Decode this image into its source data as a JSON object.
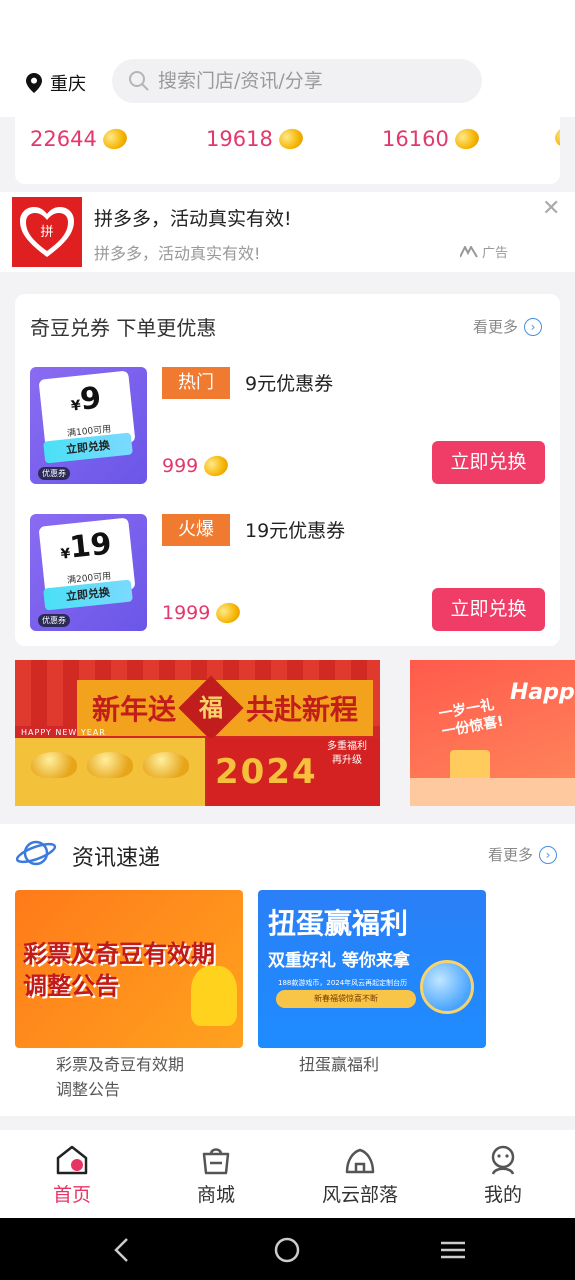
{
  "header": {
    "location": "重庆",
    "search_placeholder": "搜索门店/资讯/分享"
  },
  "points": [
    "22644",
    "19618",
    "16160"
  ],
  "ad": {
    "title": "拼多多，活动真实有效!",
    "subtitle": "拼多多，活动真实有效!",
    "tag": "广告",
    "logo_text": "拼"
  },
  "coupons": {
    "title": "奇豆兑券 下单更优惠",
    "more": "看更多",
    "items": [
      {
        "tag": "热门",
        "name": "9元优惠券",
        "price": "999",
        "button": "立即兑换",
        "img_amount": "9",
        "img_cond": "满100可用",
        "img_btn": "立即兑换",
        "img_tag": "优惠券"
      },
      {
        "tag": "火爆",
        "name": "19元优惠券",
        "price": "1999",
        "button": "立即兑换",
        "img_amount": "19",
        "img_cond": "满200可用",
        "img_btn": "立即兑换",
        "img_tag": "优惠券"
      }
    ]
  },
  "banners": {
    "b1_left": "新年送",
    "b1_fu": "福",
    "b1_right": "共赴新程",
    "b1_hny": "HAPPY NEW YEAR",
    "b1_year": "2024",
    "b1_side": "多重福利 再升级",
    "b2_text1": "一岁一礼",
    "b2_text2": "一份惊喜!",
    "b2_happy": "Happy"
  },
  "news": {
    "title": "资讯速递",
    "more": "看更多",
    "items": [
      {
        "img_text1": "彩票及奇豆有效期",
        "img_text2": "调整公告",
        "caption1": "彩票及奇豆有效期",
        "caption2": "调整公告"
      },
      {
        "img_big": "扭蛋赢福利",
        "img_mid": "双重好礼 等你来拿",
        "img_small": "188款游戏币，2024年风云再起定制台历",
        "img_badge": "新春福袋惊喜不断",
        "caption1": "扭蛋赢福利"
      }
    ]
  },
  "tabs": [
    {
      "label": "首页",
      "icon": "home-icon"
    },
    {
      "label": "商城",
      "icon": "shop-icon"
    },
    {
      "label": "风云部落",
      "icon": "tribe-icon"
    },
    {
      "label": "我的",
      "icon": "profile-icon"
    }
  ],
  "colors": {
    "accent": "#e83464",
    "orange_tag": "#f07a30",
    "price": "#e2396c"
  }
}
